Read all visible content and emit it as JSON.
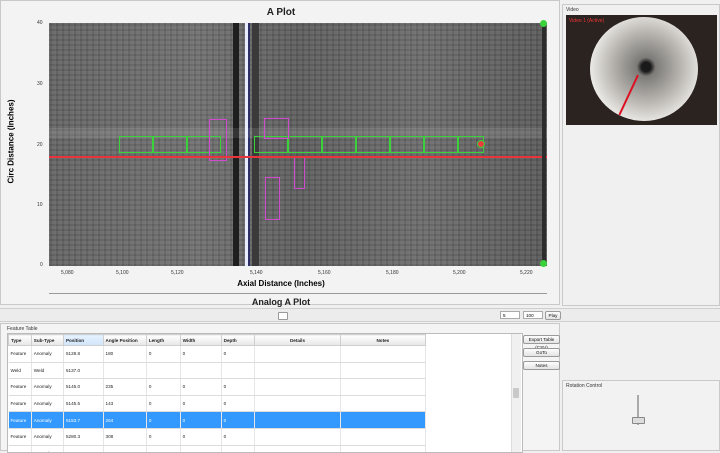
{
  "aplot": {
    "title": "A Plot",
    "xlabel": "Axial Distance (Inches)",
    "ylabel": "Circ Distance (Inches)",
    "x_ticks": [
      "5,080",
      "5,100",
      "5,120",
      "5,140",
      "5,160",
      "5,180",
      "5,200",
      "5,220"
    ],
    "y_ticks": [
      "40",
      "30",
      "20",
      "10",
      "0"
    ]
  },
  "analog": {
    "title": "Analog A Plot"
  },
  "video": {
    "title": "Video",
    "overlay": "Video 1 (Active)"
  },
  "controls": {
    "step_value": "5",
    "speed_value": "100",
    "play_label": "Play"
  },
  "feature_table": {
    "title": "Feature Table",
    "columns": [
      "Type",
      "Sub-Type",
      "Position",
      "Angle Position",
      "Length",
      "Width",
      "Depth",
      "Details",
      "Notes"
    ],
    "rows": [
      [
        "Feature",
        "Anomaly",
        "5128.8",
        "180",
        "0",
        "0",
        "0",
        "",
        ""
      ],
      [
        "Weld",
        "Weld",
        "5137.0",
        "",
        "",
        "",
        "",
        "",
        ""
      ],
      [
        "Feature",
        "Anomaly",
        "5145.0",
        "235",
        "0",
        "0",
        "0",
        "",
        ""
      ],
      [
        "Feature",
        "Anomaly",
        "5145.5",
        "143",
        "0",
        "0",
        "0",
        "",
        ""
      ],
      [
        "Feature",
        "Anomaly",
        "5153.7",
        "264",
        "0",
        "0",
        "0",
        "",
        ""
      ],
      [
        "Feature",
        "Anomaly",
        "5280.3",
        "308",
        "0",
        "0",
        "0",
        "",
        ""
      ],
      [
        "Feature",
        "Anomaly",
        "5335.0",
        "249",
        "0",
        "0",
        "0",
        "",
        ""
      ]
    ],
    "selected_row": 4,
    "buttons": {
      "export": "Export Table (CSV)",
      "goto": "GoTo",
      "notes": "Notes"
    }
  },
  "rotation": {
    "title": "Rotation Control"
  },
  "colors": {
    "cursor_line": "#e8343a",
    "weld_box": "#3ad13a",
    "anomaly_box": "#d04ad0",
    "selection": "#3399ff"
  }
}
